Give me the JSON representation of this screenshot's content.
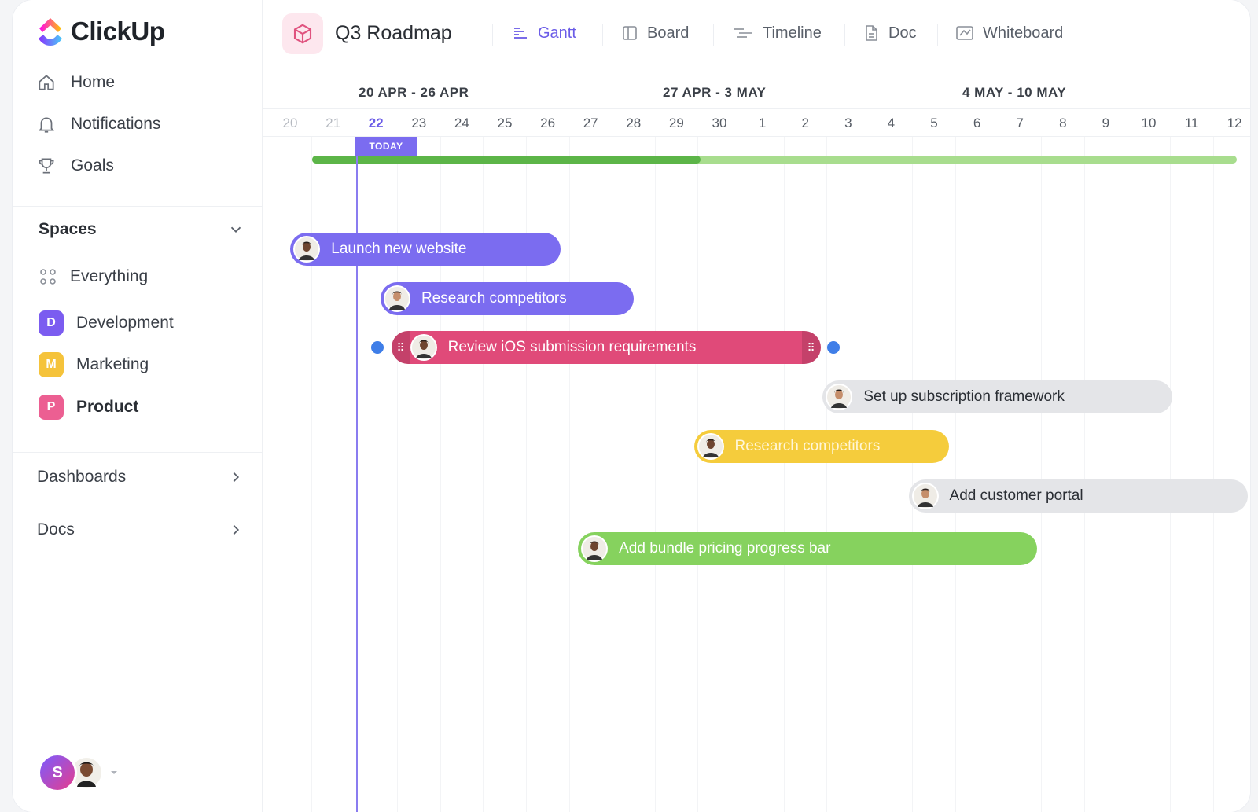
{
  "app": {
    "name": "ClickUp"
  },
  "sidebar": {
    "nav": [
      {
        "label": "Home",
        "icon": "home-icon"
      },
      {
        "label": "Notifications",
        "icon": "bell-icon"
      },
      {
        "label": "Goals",
        "icon": "trophy-icon"
      }
    ],
    "spaces_title": "Spaces",
    "everything_label": "Everything",
    "spaces": [
      {
        "letter": "D",
        "label": "Development",
        "color": "#7b5cf0"
      },
      {
        "letter": "M",
        "label": "Marketing",
        "color": "#f5c33b"
      },
      {
        "letter": "P",
        "label": "Product",
        "color": "#ec5f92"
      }
    ],
    "dashboards_label": "Dashboards",
    "docs_label": "Docs",
    "user_initial": "S"
  },
  "header": {
    "project_title": "Q3 Roadmap",
    "tabs": [
      {
        "label": "Gantt",
        "icon": "gantt-icon",
        "active": true
      },
      {
        "label": "Board",
        "icon": "board-icon",
        "active": false
      },
      {
        "label": "Timeline",
        "icon": "timeline-icon",
        "active": false
      },
      {
        "label": "Doc",
        "icon": "doc-icon",
        "active": false
      },
      {
        "label": "Whiteboard",
        "icon": "whiteboard-icon",
        "active": false
      }
    ]
  },
  "gantt": {
    "weeks": [
      "20 APR - 26 APR",
      "27 APR - 3 MAY",
      "4 MAY - 10 MAY"
    ],
    "days": [
      "20",
      "21",
      "22",
      "23",
      "24",
      "25",
      "26",
      "27",
      "28",
      "29",
      "30",
      "1",
      "2",
      "3",
      "4",
      "5",
      "6",
      "7",
      "8",
      "9",
      "10",
      "11",
      "12"
    ],
    "today_index": 2,
    "today_label": "TODAY",
    "overall_progress": 0.42,
    "colors": {
      "purple": "#7b6cf0",
      "red": "#e04a79",
      "gray": "#e4e5e8",
      "yellow": "#f5cc3c",
      "green": "#86d25e"
    },
    "tasks": [
      {
        "label": "Launch new website",
        "color": "purple",
        "start": 0.5,
        "end": 6.8
      },
      {
        "label": "Research competitors",
        "color": "purple",
        "start": 2.6,
        "end": 8.5
      },
      {
        "label": "Review iOS submission requirements",
        "color": "red",
        "start": 2.85,
        "end": 12.85,
        "selected": true
      },
      {
        "label": "Set up subscription framework",
        "color": "gray",
        "start": 12.9,
        "end": 21.05
      },
      {
        "label": "Research competitors",
        "color": "yellow",
        "start": 9.9,
        "end": 15.85
      },
      {
        "label": "Add customer portal",
        "color": "gray",
        "start": 14.9,
        "end": 22.8
      },
      {
        "label": "Add bundle pricing progress bar",
        "color": "green",
        "start": 7.2,
        "end": 17.9
      }
    ]
  }
}
